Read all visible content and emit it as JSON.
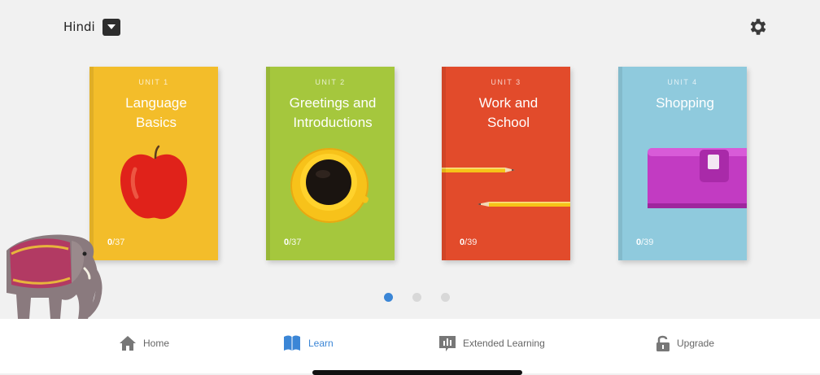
{
  "header": {
    "language": "Hindi",
    "settings_icon": "gear-icon",
    "dropdown_icon": "chevron-down-icon"
  },
  "units": [
    {
      "unit": "UNIT 1",
      "title_line1": "Language",
      "title_line2": "Basics",
      "progress_done": "0",
      "progress_total": "/37",
      "color": "#f3bd2a",
      "art_icon": "apple-icon"
    },
    {
      "unit": "UNIT 2",
      "title_line1": "Greetings and",
      "title_line2": "Introductions",
      "progress_done": "0",
      "progress_total": "/37",
      "color": "#a5c73d",
      "art_icon": "coffee-cup-icon"
    },
    {
      "unit": "UNIT 3",
      "title_line1": "Work and",
      "title_line2": "School",
      "progress_done": "0",
      "progress_total": "/39",
      "color": "#e24b2b",
      "art_icon": "pencil-icon"
    },
    {
      "unit": "UNIT 4",
      "title_line1": "Shopping",
      "title_line2": "",
      "progress_done": "0",
      "progress_total": "/39",
      "color": "#8fcadd",
      "art_icon": "wallet-icon"
    }
  ],
  "pager": {
    "pages": 3,
    "active": 1
  },
  "nav": {
    "home": "Home",
    "learn": "Learn",
    "extended": "Extended Learning",
    "upgrade": "Upgrade",
    "active": "Learn",
    "accent": "#3b86d6"
  },
  "decor": {
    "mascot_icon": "elephant-icon"
  }
}
